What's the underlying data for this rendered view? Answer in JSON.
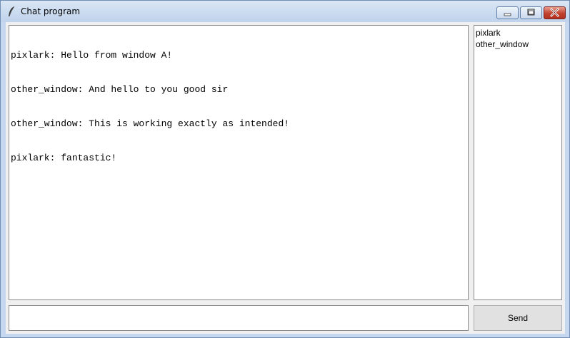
{
  "window": {
    "title": "Chat program",
    "icon": "feather-icon",
    "controls": [
      "minimize-icon",
      "maximize-icon",
      "close-icon"
    ]
  },
  "chat_log": {
    "lines": [
      "pixlark: Hello from window A!",
      "other_window: And hello to you good sir",
      "other_window: This is working exactly as intended!",
      "pixlark: fantastic!"
    ]
  },
  "user_list": {
    "users": [
      "pixlark",
      "other_window"
    ]
  },
  "message_input": {
    "value": ""
  },
  "send_button": {
    "label": "Send"
  }
}
